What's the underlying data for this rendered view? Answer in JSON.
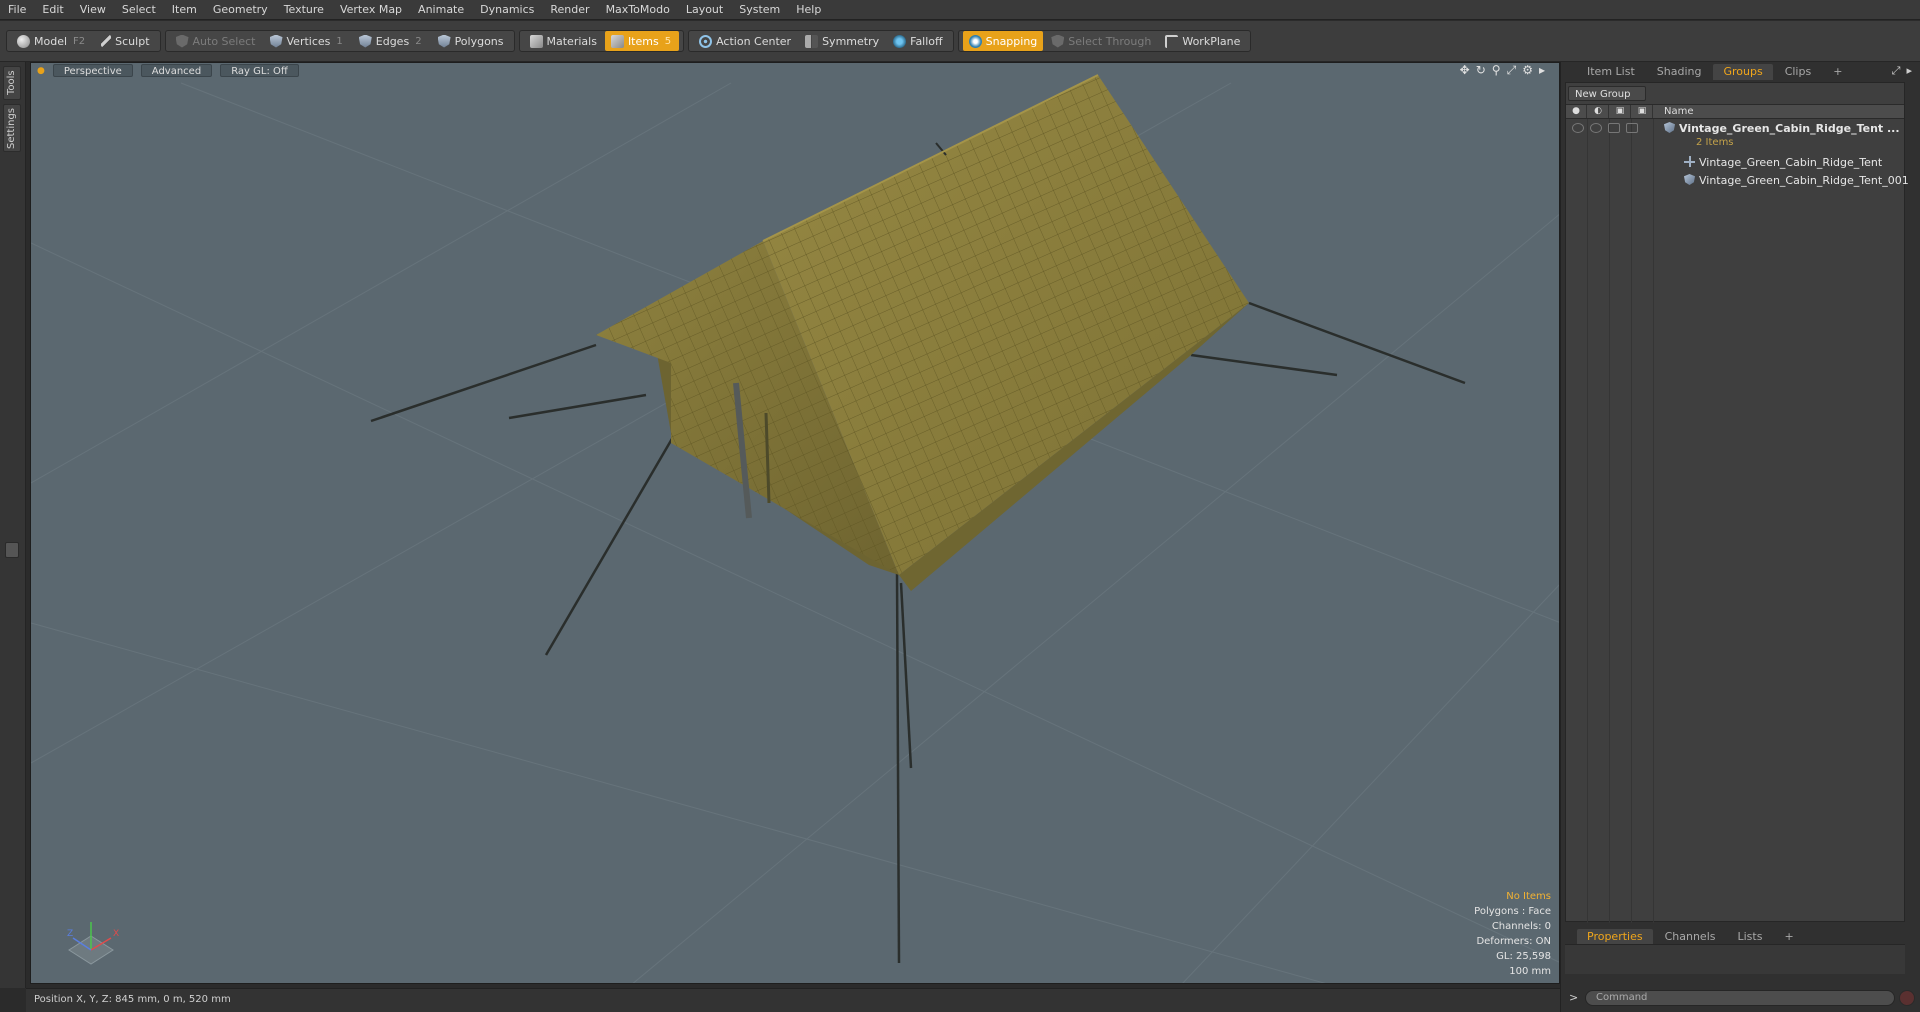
{
  "menu": [
    "File",
    "Edit",
    "View",
    "Select",
    "Item",
    "Geometry",
    "Texture",
    "Vertex Map",
    "Animate",
    "Dynamics",
    "Render",
    "MaxToModo",
    "Layout",
    "System",
    "Help"
  ],
  "toolbar": {
    "model": "Model",
    "model_key": "F2",
    "sculpt": "Sculpt",
    "auto_select": "Auto Select",
    "vertices": "Vertices",
    "vertices_key": "1",
    "edges": "Edges",
    "edges_key": "2",
    "polygons": "Polygons",
    "materials": "Materials",
    "items": "Items",
    "items_key": "5",
    "action_center": "Action Center",
    "symmetry": "Symmetry",
    "falloff": "Falloff",
    "snapping": "Snapping",
    "select_through": "Select Through",
    "workplane": "WorkPlane"
  },
  "left_tabs": [
    "Tools",
    "Settings"
  ],
  "viewport": {
    "view_mode": "Perspective",
    "shading": "Advanced",
    "raygl": "Ray GL: Off",
    "info": {
      "selection": "No Items",
      "polygons": "Polygons : Face",
      "channels": "Channels: 0",
      "deformers": "Deformers: ON",
      "gl": "GL: 25,598",
      "grid": "100 mm"
    },
    "axis": {
      "z": "Z",
      "x": "X"
    }
  },
  "status": {
    "position": "Position X, Y, Z:   845 mm, 0 m, 520 mm"
  },
  "right_panel": {
    "tabs": [
      "Item List",
      "Shading",
      "Groups",
      "Clips"
    ],
    "active_tab": "Groups",
    "new_group": "New Group",
    "name_column": "Name",
    "group_name": "Vintage_Green_Cabin_Ridge_Tent ...",
    "group_count": "2 Items",
    "children": [
      "Vintage_Green_Cabin_Ridge_Tent",
      "Vintage_Green_Cabin_Ridge_Tent_001"
    ],
    "bottom_tabs": [
      "Properties",
      "Channels",
      "Lists"
    ],
    "active_bottom_tab": "Properties",
    "command_placeholder": "Command",
    "command_prompt": ">"
  },
  "colors": {
    "accent": "#e8a21a",
    "viewport_bg": "#5b6870",
    "tent": "#8a7e3e"
  }
}
